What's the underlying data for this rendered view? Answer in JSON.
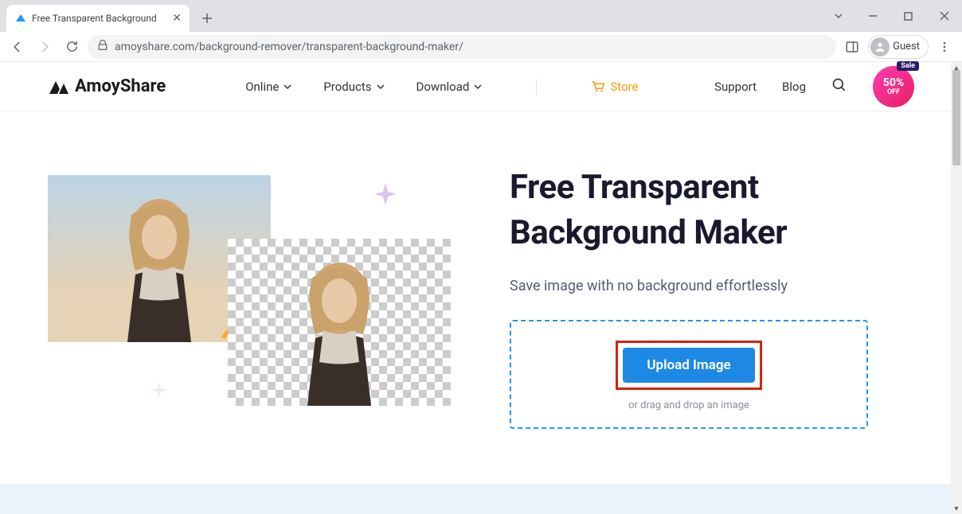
{
  "browser": {
    "tab_title": "Free Transparent Background",
    "url_host": "amoyshare.com",
    "url_path": "/background-remover/transparent-background-maker/",
    "guest_label": "Guest"
  },
  "nav": {
    "logo": "AmoyShare",
    "items": [
      "Online",
      "Products",
      "Download"
    ],
    "store": "Store",
    "support": "Support",
    "blog": "Blog",
    "sale_tag": "Sale",
    "sale_pct": "50%",
    "sale_off": "OFF"
  },
  "hero": {
    "title_l1": "Free Transparent",
    "title_l2": "Background Maker",
    "subtitle": "Save image with no background effortlessly",
    "upload_label": "Upload Image",
    "drag_hint": "or drag and drop an image"
  }
}
